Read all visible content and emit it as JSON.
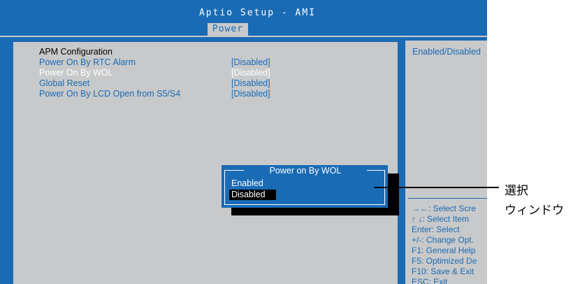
{
  "window": {
    "title": "Aptio Setup - AMI"
  },
  "tabs": [
    {
      "label": "Power",
      "active": true
    }
  ],
  "section": {
    "title": "APM Configuration"
  },
  "settings": [
    {
      "label": "Power On By RTC Alarm",
      "value": "[Disabled]",
      "highlighted": false
    },
    {
      "label": "Power On By WOL",
      "value": "[Disabled]",
      "highlighted": true
    },
    {
      "label": "Global Reset",
      "value": "[Disabled]",
      "highlighted": false
    },
    {
      "label": "Power On By LCD Open from S5/S4",
      "value": "[Disabled]",
      "highlighted": false
    }
  ],
  "help": {
    "description": "Enabled/Disabled",
    "keys": [
      "→←: Select Scre",
      "↑ ↓: Select Item",
      "Enter: Select",
      "+/-: Change Opt.",
      "F1: General Help",
      "F5: Optimized De",
      "F10: Save & Exit",
      "ESC: Exit"
    ]
  },
  "popup": {
    "title": "Power on By WOL",
    "options": [
      {
        "label": "Enabled",
        "selected": false
      },
      {
        "label": "Disabled",
        "selected": true
      }
    ]
  },
  "annotation": {
    "line1": "選択",
    "line2": "ウィンドウ"
  },
  "colors": {
    "bios_blue": "#1a6bb5",
    "panel_gray": "#c8c9ca",
    "white": "#ffffff",
    "black": "#000000"
  }
}
